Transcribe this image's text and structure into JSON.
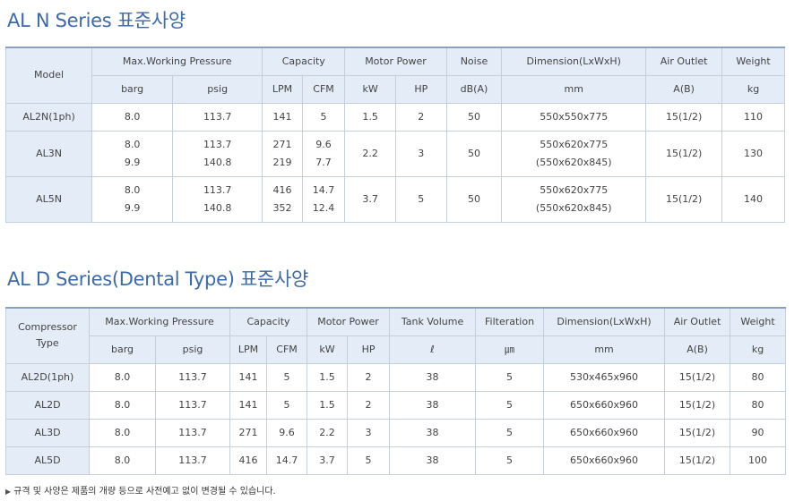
{
  "section1": {
    "title": "AL N Series 표준사양",
    "headers": {
      "model": "Model",
      "pressure": "Max.Working Pressure",
      "capacity": "Capacity",
      "motor": "Motor Power",
      "noise": "Noise",
      "dimension": "Dimension(LxWxH)",
      "outlet": "Air Outlet",
      "weight": "Weight"
    },
    "units": {
      "barg": "barg",
      "psig": "psig",
      "lpm": "LPM",
      "cfm": "CFM",
      "kw": "kW",
      "hp": "HP",
      "noise": "dB(A)",
      "dimension": "mm",
      "outlet": "A(B)",
      "weight": "kg"
    },
    "rows": [
      {
        "model": "AL2N(1ph)",
        "barg": [
          "8.0"
        ],
        "psig": [
          "113.7"
        ],
        "lpm": [
          "141"
        ],
        "cfm": [
          "5"
        ],
        "kw": "1.5",
        "hp": "2",
        "noise": "50",
        "dimension": [
          "550x550x775"
        ],
        "outlet": "15(1/2)",
        "weight": "110"
      },
      {
        "model": "AL3N",
        "barg": [
          "8.0",
          "9.9"
        ],
        "psig": [
          "113.7",
          "140.8"
        ],
        "lpm": [
          "271",
          "219"
        ],
        "cfm": [
          "9.6",
          "7.7"
        ],
        "kw": "2.2",
        "hp": "3",
        "noise": "50",
        "dimension": [
          "550x620x775",
          "(550x620x845)"
        ],
        "outlet": "15(1/2)",
        "weight": "130"
      },
      {
        "model": "AL5N",
        "barg": [
          "8.0",
          "9.9"
        ],
        "psig": [
          "113.7",
          "140.8"
        ],
        "lpm": [
          "416",
          "352"
        ],
        "cfm": [
          "14.7",
          "12.4"
        ],
        "kw": "3.7",
        "hp": "5",
        "noise": "50",
        "dimension": [
          "550x620x775",
          "(550x620x845)"
        ],
        "outlet": "15(1/2)",
        "weight": "140"
      }
    ]
  },
  "section2": {
    "title": "AL D Series(Dental Type) 표준사양",
    "headers": {
      "model_line1": "Compressor",
      "model_line2": "Type",
      "pressure": "Max.Working Pressure",
      "capacity": "Capacity",
      "motor": "Motor Power",
      "tank": "Tank Volume",
      "filter": "Filteration",
      "dimension": "Dimension(LxWxH)",
      "outlet": "Air Outlet",
      "weight": "Weight"
    },
    "units": {
      "barg": "barg",
      "psig": "psig",
      "lpm": "LPM",
      "cfm": "CFM",
      "kw": "kW",
      "hp": "HP",
      "tank": "ℓ",
      "filter": "㎛",
      "dimension": "mm",
      "outlet": "A(B)",
      "weight": "kg"
    },
    "rows": [
      {
        "model": "AL2D(1ph)",
        "barg": "8.0",
        "psig": "113.7",
        "lpm": "141",
        "cfm": "5",
        "kw": "1.5",
        "hp": "2",
        "tank": "38",
        "filter": "5",
        "dimension": "530x465x960",
        "outlet": "15(1/2)",
        "weight": "80"
      },
      {
        "model": "AL2D",
        "barg": "8.0",
        "psig": "113.7",
        "lpm": "141",
        "cfm": "5",
        "kw": "1.5",
        "hp": "2",
        "tank": "38",
        "filter": "5",
        "dimension": "650x660x960",
        "outlet": "15(1/2)",
        "weight": "80"
      },
      {
        "model": "AL3D",
        "barg": "8.0",
        "psig": "113.7",
        "lpm": "271",
        "cfm": "9.6",
        "kw": "2.2",
        "hp": "3",
        "tank": "38",
        "filter": "5",
        "dimension": "650x660x960",
        "outlet": "15(1/2)",
        "weight": "90"
      },
      {
        "model": "AL5D",
        "barg": "8.0",
        "psig": "113.7",
        "lpm": "416",
        "cfm": "14.7",
        "kw": "3.7",
        "hp": "5",
        "tank": "38",
        "filter": "5",
        "dimension": "650x660x960",
        "outlet": "15(1/2)",
        "weight": "100"
      }
    ]
  },
  "footnote": "규격 및 사양은 제품의 개량 등으로 사전예고 없이 변경될 수 있습니다.",
  "colors": {
    "title": "#3d6aa8",
    "header_bg": "#e3ecf7",
    "border": "#c5cfdc",
    "top_border": "#8aa2c0"
  },
  "icons": {
    "footnote_bullet": "triangle-bullet-icon"
  }
}
